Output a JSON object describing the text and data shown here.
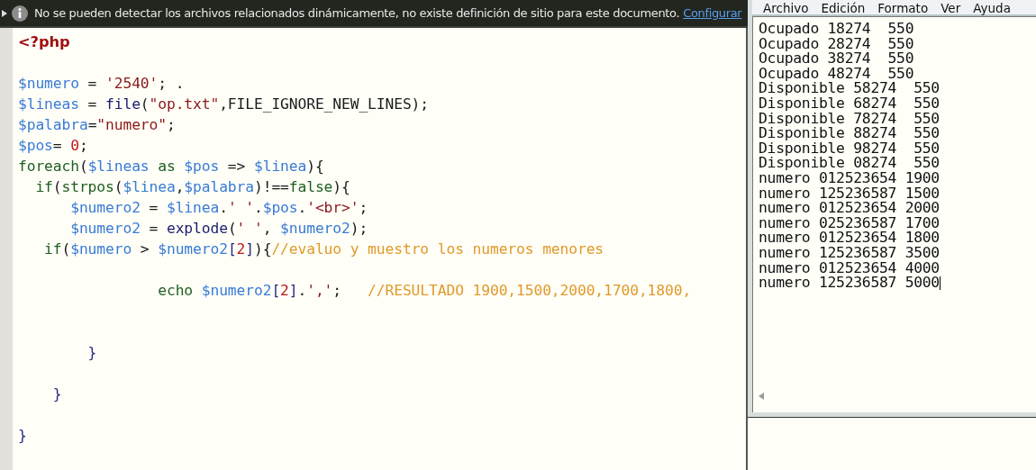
{
  "notification": {
    "text": "No se pueden detectar los archivos relacionados dinámicamente, no existe definición de sitio para este documento.",
    "link": "Configurar"
  },
  "editor": {
    "lines": [
      {
        "kind": "code",
        "tokens": [
          {
            "kind": "tag",
            "text": "<?php"
          }
        ]
      },
      {
        "kind": "blank"
      },
      {
        "kind": "code",
        "tokens": [
          {
            "kind": "var",
            "text": "$numero"
          },
          {
            "kind": "plain",
            "text": " = "
          },
          {
            "kind": "str",
            "text": "'2540'"
          },
          {
            "kind": "plain",
            "text": "; ."
          }
        ]
      },
      {
        "kind": "code",
        "tokens": [
          {
            "kind": "var",
            "text": "$lineas"
          },
          {
            "kind": "plain",
            "text": " = "
          },
          {
            "kind": "fn",
            "text": "file"
          },
          {
            "kind": "plain",
            "text": "("
          },
          {
            "kind": "str",
            "text": "\"op.txt\""
          },
          {
            "kind": "plain",
            "text": ",FILE_IGNORE_NEW_LINES);"
          }
        ]
      },
      {
        "kind": "code",
        "tokens": [
          {
            "kind": "var",
            "text": "$palabra"
          },
          {
            "kind": "plain",
            "text": "="
          },
          {
            "kind": "str",
            "text": "\"numero\""
          },
          {
            "kind": "plain",
            "text": ";"
          }
        ]
      },
      {
        "kind": "code",
        "tokens": [
          {
            "kind": "var",
            "text": "$pos"
          },
          {
            "kind": "plain",
            "text": "= "
          },
          {
            "kind": "num",
            "text": "0"
          },
          {
            "kind": "plain",
            "text": ";"
          }
        ]
      },
      {
        "kind": "code",
        "tokens": [
          {
            "kind": "kw",
            "text": "foreach"
          },
          {
            "kind": "plain",
            "text": "("
          },
          {
            "kind": "var",
            "text": "$lineas"
          },
          {
            "kind": "kw",
            "text": " as "
          },
          {
            "kind": "var",
            "text": "$pos"
          },
          {
            "kind": "plain",
            "text": " => "
          },
          {
            "kind": "var",
            "text": "$linea"
          },
          {
            "kind": "plain",
            "text": "){"
          }
        ]
      },
      {
        "kind": "code",
        "tokens": [
          {
            "kind": "kw",
            "text": "  if"
          },
          {
            "kind": "plain",
            "text": "("
          },
          {
            "kind": "kw",
            "text": "strpos"
          },
          {
            "kind": "plain",
            "text": "("
          },
          {
            "kind": "var",
            "text": "$linea"
          },
          {
            "kind": "plain",
            "text": ","
          },
          {
            "kind": "var",
            "text": "$palabra"
          },
          {
            "kind": "plain",
            "text": ")!=="
          },
          {
            "kind": "kw",
            "text": "false"
          },
          {
            "kind": "plain",
            "text": "){"
          }
        ]
      },
      {
        "kind": "code",
        "tokens": [
          {
            "kind": "var",
            "text": "      $numero2"
          },
          {
            "kind": "plain",
            "text": " = "
          },
          {
            "kind": "var",
            "text": "$linea"
          },
          {
            "kind": "plain",
            "text": "."
          },
          {
            "kind": "str",
            "text": "' '"
          },
          {
            "kind": "plain",
            "text": "."
          },
          {
            "kind": "var",
            "text": "$pos"
          },
          {
            "kind": "plain",
            "text": "."
          },
          {
            "kind": "str",
            "text": "'<br>'"
          },
          {
            "kind": "plain",
            "text": ";"
          }
        ]
      },
      {
        "kind": "code",
        "tokens": [
          {
            "kind": "var",
            "text": "      $numero2"
          },
          {
            "kind": "plain",
            "text": " = "
          },
          {
            "kind": "fn",
            "text": "explode"
          },
          {
            "kind": "plain",
            "text": "("
          },
          {
            "kind": "str",
            "text": "' '"
          },
          {
            "kind": "plain",
            "text": ", "
          },
          {
            "kind": "var",
            "text": "$numero2"
          },
          {
            "kind": "plain",
            "text": ");"
          }
        ]
      },
      {
        "kind": "code",
        "tokens": [
          {
            "kind": "kw",
            "text": "   if"
          },
          {
            "kind": "plain",
            "text": "("
          },
          {
            "kind": "var",
            "text": "$numero"
          },
          {
            "kind": "plain",
            "text": " > "
          },
          {
            "kind": "var",
            "text": "$numero2"
          },
          {
            "kind": "brace",
            "text": "["
          },
          {
            "kind": "num",
            "text": "2"
          },
          {
            "kind": "brace",
            "text": "]"
          },
          {
            "kind": "plain",
            "text": "){"
          },
          {
            "kind": "comment",
            "text": "//evaluo y muestro los numeros menores"
          }
        ]
      },
      {
        "kind": "blank"
      },
      {
        "kind": "code",
        "tokens": [
          {
            "kind": "kw",
            "text": "                echo "
          },
          {
            "kind": "var",
            "text": "$numero2"
          },
          {
            "kind": "brace",
            "text": "["
          },
          {
            "kind": "num",
            "text": "2"
          },
          {
            "kind": "brace",
            "text": "]"
          },
          {
            "kind": "plain",
            "text": "."
          },
          {
            "kind": "str",
            "text": "','"
          },
          {
            "kind": "plain",
            "text": ";   "
          },
          {
            "kind": "comment",
            "text": "//RESULTADO 1900,1500,2000,1700,1800,"
          }
        ]
      },
      {
        "kind": "blank"
      },
      {
        "kind": "blank"
      },
      {
        "kind": "code",
        "tokens": [
          {
            "kind": "brace",
            "text": "        }"
          }
        ]
      },
      {
        "kind": "blank"
      },
      {
        "kind": "code",
        "tokens": [
          {
            "kind": "brace",
            "text": "    }"
          }
        ]
      },
      {
        "kind": "blank"
      },
      {
        "kind": "code",
        "tokens": [
          {
            "kind": "brace",
            "text": "}"
          }
        ]
      }
    ]
  },
  "notepad": {
    "menu": [
      "Archivo",
      "Edición",
      "Formato",
      "Ver",
      "Ayuda"
    ],
    "lines": [
      "Ocupado 18274  550",
      "Ocupado 28274  550",
      "Ocupado 38274  550",
      "Ocupado 48274  550",
      "Disponible 58274  550",
      "Disponible 68274  550",
      "Disponible 78274  550",
      "Disponible 88274  550",
      "Disponible 98274  550",
      "Disponible 08274  550",
      "numero 012523654 1900",
      "numero 125236587 1500",
      "numero 012523654 2000",
      "numero 025236587 1700",
      "numero 012523654 1800",
      "numero 125236587 3500",
      "numero 012523654 4000",
      "numero 125236587 5000"
    ]
  }
}
